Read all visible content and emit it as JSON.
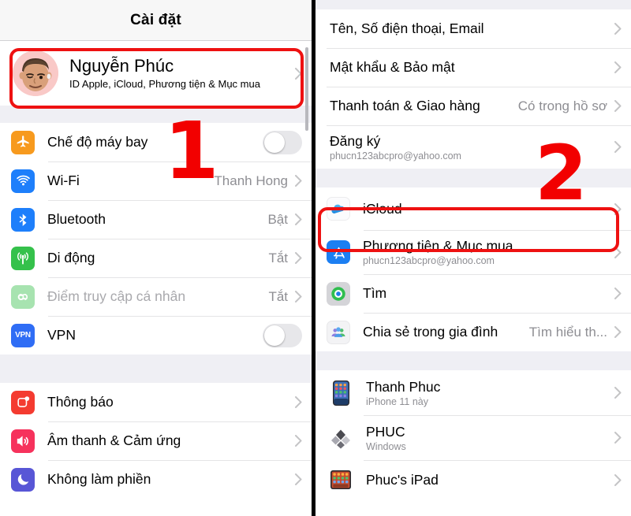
{
  "annotations": {
    "step_one": "1",
    "step_two": "2",
    "highlight_color": "#ee1111",
    "number_color": "#f20000"
  },
  "left_panel": {
    "navbar": {
      "title": "Cài đặt"
    },
    "account": {
      "name": "Nguyễn Phúc",
      "subtitle": "ID Apple, iCloud, Phương tiện & Mục mua",
      "avatar_icon": "memoji-avatar",
      "chevron": "chevron-right-icon"
    },
    "group_connectivity": [
      {
        "icon": "airplane-icon",
        "label": "Chế độ máy bay",
        "control": "toggle",
        "toggle_on": false
      },
      {
        "icon": "wifi-icon",
        "label": "Wi-Fi",
        "control": "value",
        "value": "Thanh Hong"
      },
      {
        "icon": "bluetooth-icon",
        "label": "Bluetooth",
        "control": "value",
        "value": "Bật"
      },
      {
        "icon": "cellular-icon",
        "label": "Di động",
        "control": "value",
        "value": "Tắt"
      },
      {
        "icon": "hotspot-icon",
        "label": "Điểm truy cập cá nhân",
        "control": "value",
        "value": "Tắt",
        "disabled": true
      },
      {
        "icon": "vpn-icon",
        "label": "VPN",
        "control": "toggle",
        "toggle_on": false
      }
    ],
    "group_alerts": [
      {
        "icon": "notifications-icon",
        "label": "Thông báo",
        "control": "chevron"
      },
      {
        "icon": "sounds-icon",
        "label": "Âm thanh & Cảm ứng",
        "control": "chevron"
      },
      {
        "icon": "do-not-disturb-icon",
        "label": "Không làm phiền",
        "control": "chevron"
      }
    ]
  },
  "right_panel": {
    "group_account": [
      {
        "label": "Tên, Số điện thoại, Email",
        "control": "chevron"
      },
      {
        "label": "Mật khẩu & Bảo mật",
        "control": "chevron"
      },
      {
        "label": "Thanh toán & Giao hàng",
        "control": "value",
        "value": "Có trong hồ sơ"
      },
      {
        "label": "Đăng ký",
        "sub": "phucn123abcpro@yahoo.com",
        "control": "chevron"
      }
    ],
    "group_services": [
      {
        "icon": "icloud-icon",
        "label": "iCloud",
        "control": "chevron",
        "highlighted": true
      },
      {
        "icon": "appstore-icon",
        "label": "Phương tiện & Mục mua",
        "sub": "phucn123abcpro@yahoo.com",
        "control": "chevron"
      },
      {
        "icon": "findmy-icon",
        "label": "Tìm",
        "control": "chevron"
      },
      {
        "icon": "familysharing-icon",
        "label": "Chia sẻ trong gia đình",
        "control": "value",
        "value": "Tìm hiểu th..."
      }
    ],
    "group_devices": [
      {
        "icon": "iphone-device-icon",
        "label": "Thanh Phuc",
        "sub": "iPhone 11 này",
        "control": "chevron"
      },
      {
        "icon": "windows-device-icon",
        "label": "PHUC",
        "sub": "Windows",
        "control": "chevron"
      },
      {
        "icon": "ipad-device-icon",
        "label": "Phuc's iPad",
        "control": "chevron"
      }
    ]
  }
}
